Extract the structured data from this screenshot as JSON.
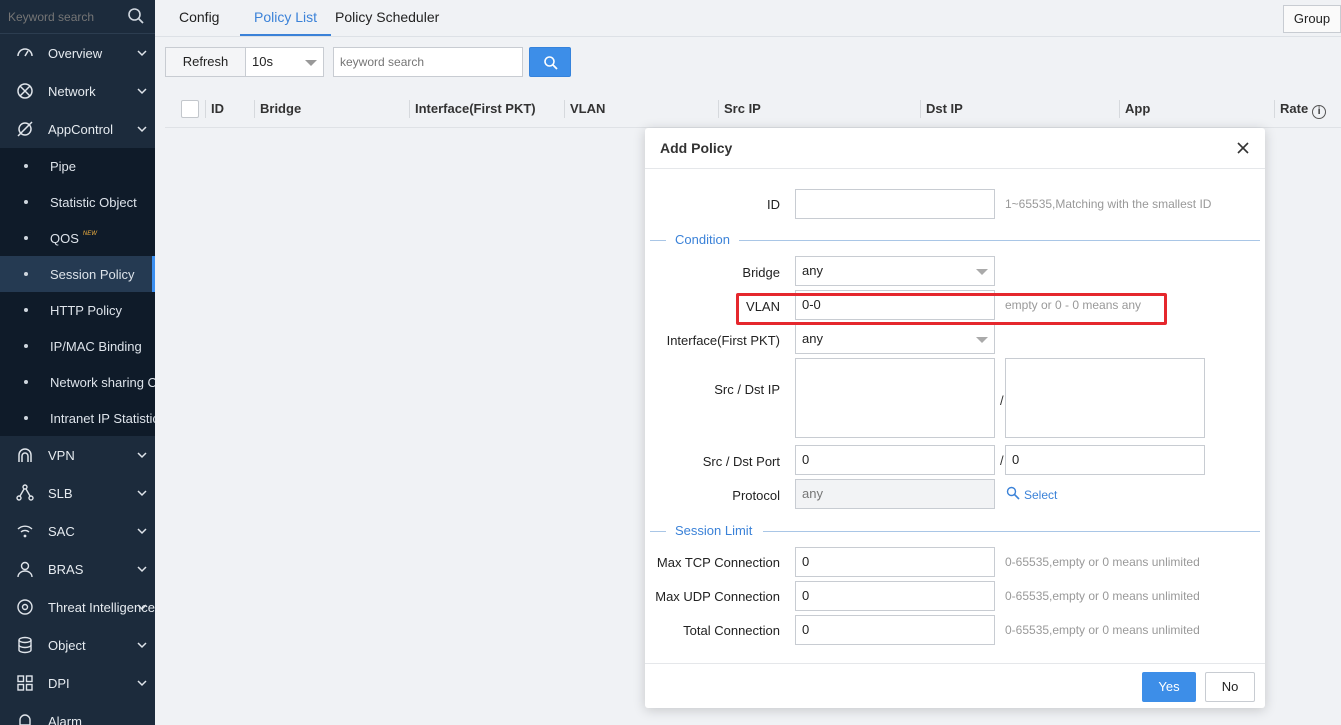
{
  "sidebar": {
    "search_placeholder": "Keyword search",
    "items": [
      {
        "label": "Overview",
        "icon": "dashboard-icon"
      },
      {
        "label": "Network",
        "icon": "network-icon"
      },
      {
        "label": "AppControl",
        "icon": "appcontrol-icon"
      }
    ],
    "sub_items": [
      "Pipe",
      "Statistic Object",
      "QOS",
      "Session Policy",
      "HTTP Policy",
      "IP/MAC Binding",
      "Network sharing Co",
      "Intranet IP Statistics"
    ],
    "qos_badge": "NEW",
    "items_after": [
      {
        "label": "VPN",
        "icon": "wifi-icon"
      },
      {
        "label": "SLB",
        "icon": "slb-icon"
      },
      {
        "label": "SAC",
        "icon": "wifi-signal-icon"
      },
      {
        "label": "BRAS",
        "icon": "user-icon"
      },
      {
        "label": "Threat Intelligence",
        "icon": "target-icon"
      },
      {
        "label": "Object",
        "icon": "database-icon"
      },
      {
        "label": "DPI",
        "icon": "grid-icon"
      },
      {
        "label": "Alarm",
        "icon": "bell-icon"
      }
    ]
  },
  "tabs": [
    "Config",
    "Policy List",
    "Policy Scheduler"
  ],
  "active_tab": "Policy List",
  "group_label": "Group",
  "toolbar": {
    "refresh_label": "Refresh",
    "interval_value": "10s",
    "search_placeholder": "keyword search"
  },
  "table": {
    "columns": [
      "ID",
      "Bridge",
      "Interface(First PKT)",
      "VLAN",
      "Src IP",
      "Dst IP",
      "App",
      "Rate"
    ]
  },
  "modal": {
    "title": "Add Policy",
    "id_label": "ID",
    "id_value": "",
    "id_hint": "1~65535,Matching with the smallest ID",
    "condition_title": "Condition",
    "bridge_label": "Bridge",
    "bridge_value": "any",
    "vlan_label": "VLAN",
    "vlan_value": "0-0",
    "vlan_hint": "empty or 0 - 0 means any",
    "iface_label": "Interface(First PKT)",
    "iface_value": "any",
    "src_dst_ip_label": "Src / Dst IP",
    "src_dst_port_label": "Src / Dst Port",
    "src_port_value": "0",
    "dst_port_value": "0",
    "slash": "/",
    "protocol_label": "Protocol",
    "protocol_value": "any",
    "select_label": "Select",
    "session_limit_title": "Session Limit",
    "max_tcp_label": "Max TCP Connection",
    "max_tcp_value": "0",
    "max_udp_label": "Max UDP Connection",
    "max_udp_value": "0",
    "total_label": "Total Connection",
    "total_value": "0",
    "limit_hint": "0-65535,empty or 0 means unlimited",
    "yes_label": "Yes",
    "no_label": "No"
  },
  "colors": {
    "sidebar_bg": "#1c2b3c",
    "accent": "#3d8ee8",
    "highlight": "#e5272d"
  }
}
